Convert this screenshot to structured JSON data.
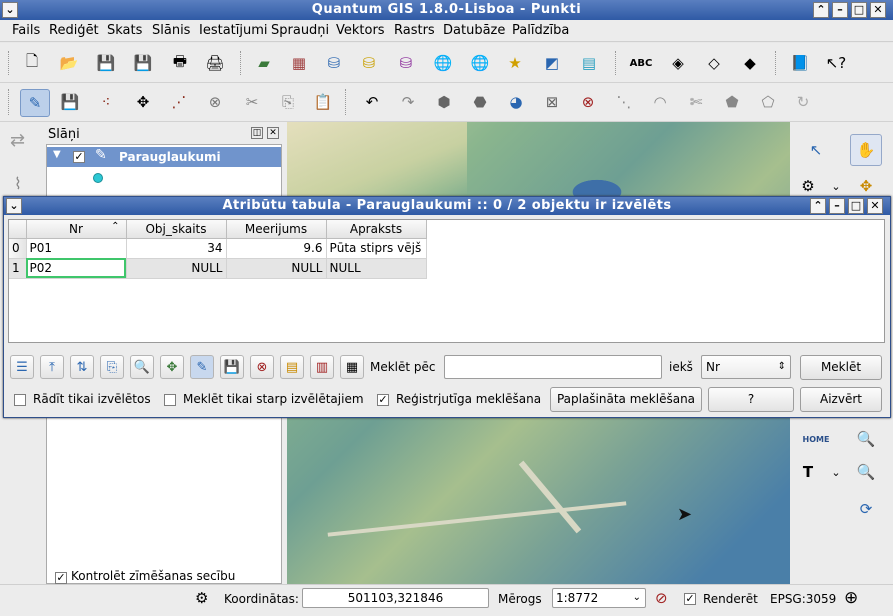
{
  "window": {
    "title": "Quantum GIS 1.8.0-Lisboa - Punkti"
  },
  "menu": [
    "Fails",
    "Rediģēt",
    "Skats",
    "Slānis",
    "Iestatījumi",
    "Spraudņi",
    "Vektors",
    "Rastrs",
    "Datubāze",
    "Palīdzība"
  ],
  "layers_panel": {
    "title": "Slāņi",
    "layer_name": "Parauglaukumi",
    "render_order_label": "Kontrolēt zīmēšanas secību"
  },
  "attribute_dialog": {
    "title": "Atribūtu tabula - Parauglaukumi :: 0 / 2 objektu ir izvēlēts",
    "columns": [
      "Nr",
      "Obj_skaits",
      "Meerijums",
      "Apraksts"
    ],
    "rows": [
      {
        "idx": "0",
        "Nr": "P01",
        "Obj_skaits": "34",
        "Meerijums": "9.6",
        "Apraksts": "Pūta stiprs vējš"
      },
      {
        "idx": "1",
        "Nr": "P02",
        "Obj_skaits": "NULL",
        "Meerijums": "NULL",
        "Apraksts": "NULL"
      }
    ],
    "search_label": "Meklēt pēc",
    "search_value": "",
    "in_label": "iekš",
    "field_select": "Nr",
    "search_button": "Meklēt",
    "show_selected_only": "Rādīt tikai izvēlētos",
    "search_selected_only": "Meklēt tikai starp izvēlētajiem",
    "case_sensitive": "Reģistrjutīga meklēšana",
    "advanced_search": "Paplašināta meklēšana",
    "help": "?",
    "close": "Aizvērt"
  },
  "statusbar": {
    "coordinates_label": "Koordinātas:",
    "coordinates_value": "501103,321846",
    "scale_label": "Mērogs",
    "scale_value": "1:8772",
    "render_label": "Renderēt",
    "crs": "EPSG:3059"
  }
}
